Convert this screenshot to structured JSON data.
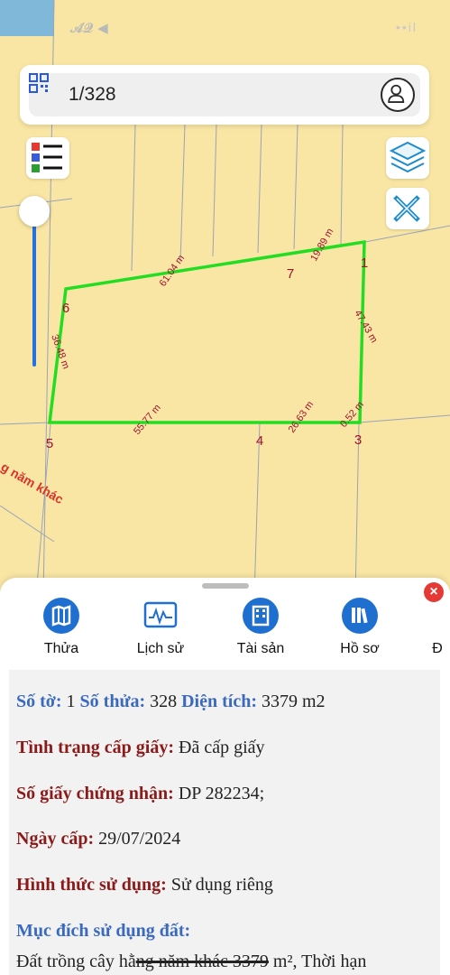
{
  "status": {
    "time": "𝒜𝒬 ◀",
    "signal": "••il"
  },
  "search": {
    "value": "1/328"
  },
  "map": {
    "points": [
      {
        "label": "1"
      },
      {
        "label": "3"
      },
      {
        "label": "4"
      },
      {
        "label": "5"
      },
      {
        "label": "6"
      },
      {
        "label": "7"
      }
    ],
    "edges": [
      "19.89 m",
      "47.43 m",
      "0.52 m",
      "26.63 m",
      "55.77 m",
      "36.48 m",
      "61.04 m"
    ],
    "road_label": "g năm khác",
    "parcel_color": "#22dd22"
  },
  "tabs": [
    {
      "label": "Thửa",
      "icon": "map-icon"
    },
    {
      "label": "Lịch sử",
      "icon": "chart-icon"
    },
    {
      "label": "Tài sản",
      "icon": "building-icon"
    },
    {
      "label": "Hồ sơ",
      "icon": "books-icon"
    },
    {
      "label": "Đ",
      "icon": "more-icon"
    }
  ],
  "info": {
    "so_to_label": "Số tờ:",
    "so_to_value": "1",
    "so_thua_label": "Số thửa:",
    "so_thua_value": "328",
    "dien_tich_label": "Diện tích:",
    "dien_tich_value": "3379 m2",
    "tinh_trang_label": "Tình trạng cấp giấy:",
    "tinh_trang_value": "Đã cấp giấy",
    "so_giay_label": "Số giấy chứng nhận:",
    "so_giay_value": "DP 282234;",
    "ngay_cap_label": "Ngày cấp:",
    "ngay_cap_value": "29/07/2024",
    "hinh_thuc_label": "Hình thức sử dụng:",
    "hinh_thuc_value": "Sử dụng riêng",
    "muc_dich_label": "Mục đích sử dụng đất:",
    "muc_dich_value_a": "Đất trồng cây hằ",
    "muc_dich_value_b": "ng năm khác 3379",
    "muc_dich_value_c": " m², Thời hạn"
  },
  "colors": {
    "accent": "#1f6fd0",
    "label_red": "#8b1a1a",
    "label_blue": "#3a6ac0",
    "close": "#e53935"
  }
}
